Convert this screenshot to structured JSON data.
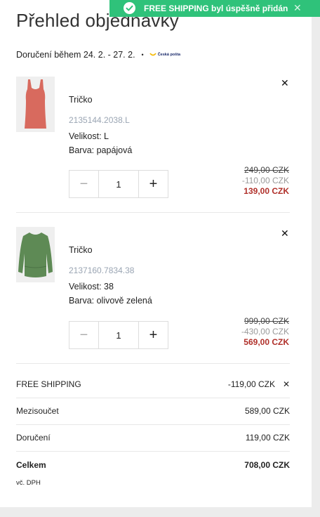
{
  "toast": {
    "message": "FREE SHIPPING byl úspěšně přidán",
    "close_icon": "close-icon",
    "accent": "#2fc27a"
  },
  "page_title": "Přehled objednávky",
  "delivery": {
    "text": "Doručení během 24. 2. - 27. 2.",
    "separator": "•",
    "carrier_logo": "Česká pošta"
  },
  "items": [
    {
      "name": "Tričko",
      "sku": "2135144.2038.L",
      "size": "Velikost: L",
      "color": "Barva: papájová",
      "quantity": "1",
      "price_original": "249,00 CZK",
      "price_discount": "-110,00 CZK",
      "price_final": "139,00 CZK",
      "image_color": "#d86a5e"
    },
    {
      "name": "Tričko",
      "sku": "2137160.7834.38",
      "size": "Velikost: 38",
      "color": "Barva: olivově zelená",
      "quantity": "1",
      "price_original": "999,00 CZK",
      "price_discount": "-430,00 CZK",
      "price_final": "569,00 CZK",
      "image_color": "#5e8a55"
    }
  ],
  "summary": {
    "free_shipping_label": "FREE SHIPPING",
    "free_shipping_value": "-119,00 CZK",
    "subtotal_label": "Mezisoučet",
    "subtotal_value": "589,00 CZK",
    "delivery_label": "Doručení",
    "delivery_value": "119,00 CZK",
    "total_label": "Celkem",
    "total_value": "708,00 CZK",
    "vat_note": "vč. DPH"
  }
}
